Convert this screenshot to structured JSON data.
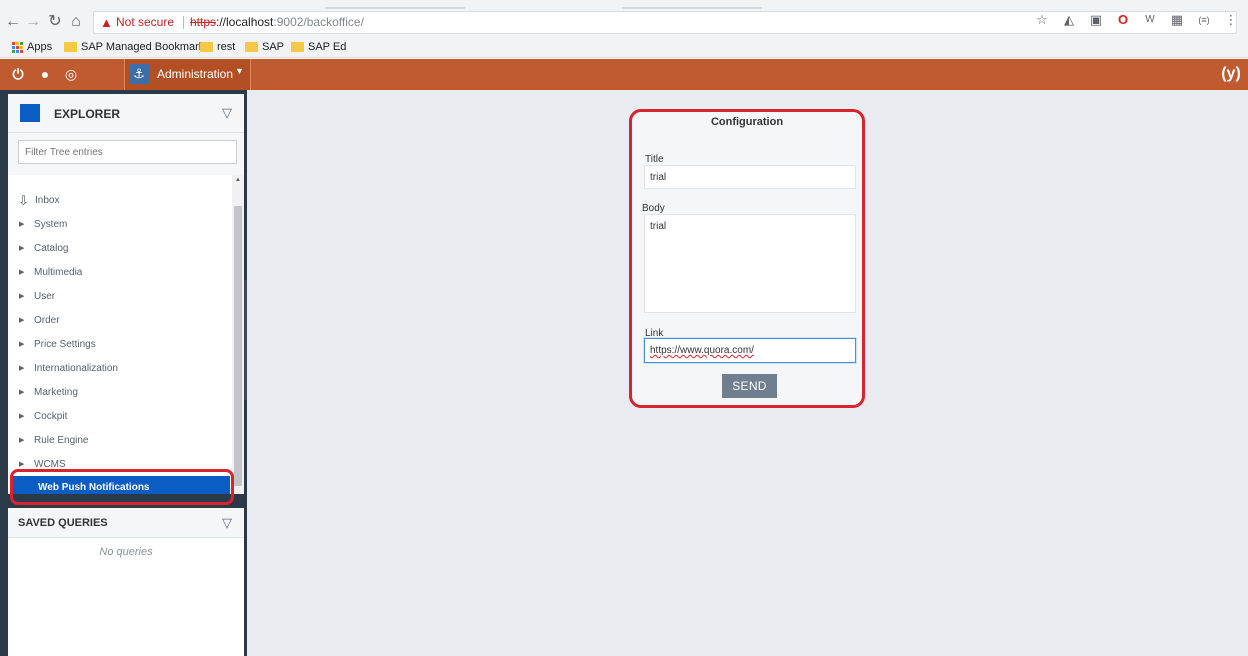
{
  "browser": {
    "not_secure": "Not secure",
    "url_scheme": "https",
    "url_rest": "://localhost",
    "url_port_path": ":9002/backoffice/",
    "bookmarks": [
      {
        "label": "Apps"
      },
      {
        "label": "SAP Managed Bookmarks"
      },
      {
        "label": "rest"
      },
      {
        "label": "SAP"
      },
      {
        "label": "SAP Ed"
      }
    ]
  },
  "header": {
    "perspective_label": "Administration",
    "brand_glyph": "(y)"
  },
  "explorer": {
    "title": "EXPLORER",
    "filter_placeholder": "Filter Tree entries",
    "items": [
      {
        "label": "Inbox"
      },
      {
        "label": "System"
      },
      {
        "label": "Catalog"
      },
      {
        "label": "Multimedia"
      },
      {
        "label": "User"
      },
      {
        "label": "Order"
      },
      {
        "label": "Price Settings"
      },
      {
        "label": "Internationalization"
      },
      {
        "label": "Marketing"
      },
      {
        "label": "Cockpit"
      },
      {
        "label": "Rule Engine"
      },
      {
        "label": "WCMS"
      },
      {
        "label": "Web Push Notifications"
      }
    ]
  },
  "saved_queries": {
    "title": "SAVED QUERIES",
    "empty_text": "No queries"
  },
  "config": {
    "title": "Configuration",
    "title_label": "Title",
    "title_value": "trial",
    "body_label": "Body",
    "body_value": "trial",
    "link_label": "Link",
    "link_value": "https://www.quora.com/",
    "send_label": "SEND"
  },
  "colors": {
    "header_bg": "#bf5b2f",
    "selected_item": "#0a5dc2",
    "highlight_border": "#d9232d",
    "panel_dark": "#2b3a48"
  }
}
